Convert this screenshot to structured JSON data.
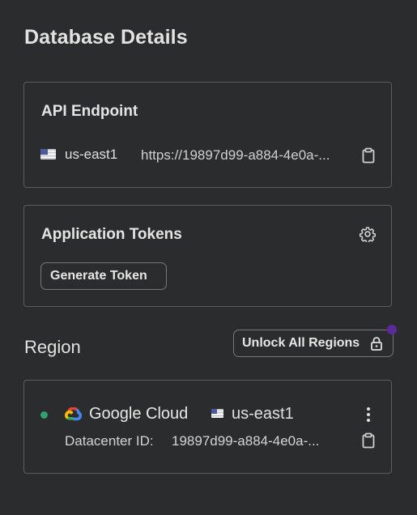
{
  "page": {
    "title": "Database Details"
  },
  "api_endpoint": {
    "title": "API Endpoint",
    "region": "us-east1",
    "url": "https://19897d99-a884-4e0a-...",
    "copy_icon": "clipboard-icon"
  },
  "tokens": {
    "title": "Application Tokens",
    "settings_icon": "gear-icon",
    "generate_label": "Generate Token"
  },
  "region": {
    "title": "Region",
    "unlock_label": "Unlock All Regions",
    "unlock_icon": "lock-icon",
    "status_color": "#2fa06f",
    "provider": "Google Cloud",
    "provider_icon": "google-cloud-icon",
    "region_code": "us-east1",
    "datacenter_label": "Datacenter ID:",
    "datacenter_id": "19897d99-a884-4e0a-...",
    "copy_icon": "clipboard-icon",
    "menu_icon": "kebab-menu-icon"
  },
  "colors": {
    "background": "#2b2c2d",
    "border": "#5c5d5f",
    "accent_dot": "#5a2a9e"
  }
}
